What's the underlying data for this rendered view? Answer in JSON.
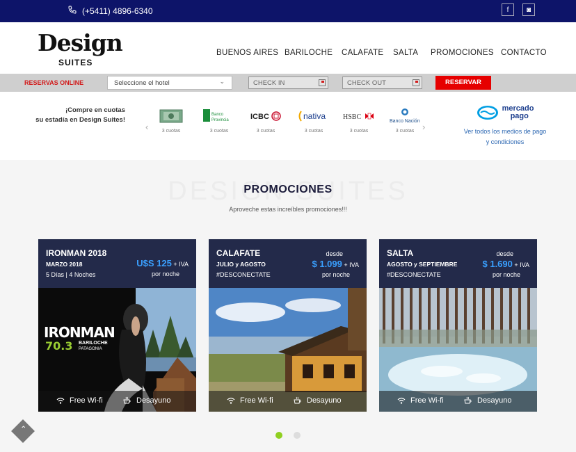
{
  "topbar": {
    "phone": "(+5411) 4896-6340",
    "social": [
      {
        "icon": "facebook-icon",
        "glyph": "f"
      },
      {
        "icon": "instagram-icon",
        "glyph": "◙"
      }
    ]
  },
  "header": {
    "logo_main": "Design",
    "logo_sub": "SUITES",
    "nav": [
      "BUENOS AIRES",
      "BARILOCHE",
      "CALAFATE",
      "SALTA",
      "PROMOCIONES",
      "CONTACTO"
    ]
  },
  "booking": {
    "label": "RESERVAS ONLINE",
    "hotel_select": "Seleccione el hotel",
    "check_in": "CHECK IN",
    "check_out": "CHECK OUT",
    "button": "RESERVAR"
  },
  "payments": {
    "promo_line1": "¡Compre en cuotas",
    "promo_line2": "su estadía en Design Suites!",
    "banks": [
      {
        "name": "American Express",
        "cuotas": "3 cuotas"
      },
      {
        "name": "Banco Provincia",
        "cuotas": "3 cuotas"
      },
      {
        "name": "ICBC",
        "cuotas": "3 cuotas"
      },
      {
        "name": "nativa",
        "cuotas": "3 cuotas"
      },
      {
        "name": "HSBC",
        "cuotas": "3 cuotas"
      },
      {
        "name": "Banco Nación",
        "cuotas": "3 cuotas"
      }
    ],
    "mercado_pago": {
      "line1": "mercado",
      "line2": "pago"
    },
    "link_line1": "Ver todos los medios de pago",
    "link_line2": "y condiciones"
  },
  "promos": {
    "ghost": "DESIGN SUITES",
    "title": "PROMOCIONES",
    "subtitle": "Aproveche estas increíbles promociones!!!",
    "cards": [
      {
        "name": "IRONMAN 2018",
        "date": "MARZO 2018",
        "extra": "5 Días | 4 Noches",
        "desde": "",
        "price": "U$S 125",
        "iva": "+ IVA",
        "per_night": "por noche",
        "wifi": "Free Wi-fi",
        "desayuno": "Desayuno",
        "overlay_line1": "IRONMAN",
        "overlay_line2": "70.3",
        "overlay_line3": "BARILOCHE",
        "overlay_line4": "PATAGONIA"
      },
      {
        "name": "CALAFATE",
        "date": "JULIO y AGOSTO",
        "extra": "#DESCONECTATE",
        "desde": "desde",
        "price": "$ 1.099",
        "iva": "+ IVA",
        "per_night": "por noche",
        "wifi": "Free Wi-fi",
        "desayuno": "Desayuno"
      },
      {
        "name": "SALTA",
        "date": "AGOSTO y SEPTIEMBRE",
        "extra": "#DESCONECTATE",
        "desde": "desde",
        "price": "$ 1.690",
        "iva": "+ IVA",
        "per_night": "por noche",
        "wifi": "Free Wi-fi",
        "desayuno": "Desayuno"
      }
    ]
  },
  "colors": {
    "topbar": "#0d1469",
    "accent_red": "#e60000",
    "card": "#232a4a",
    "price_blue": "#3aa0ff",
    "dot_active": "#8fcf20"
  }
}
